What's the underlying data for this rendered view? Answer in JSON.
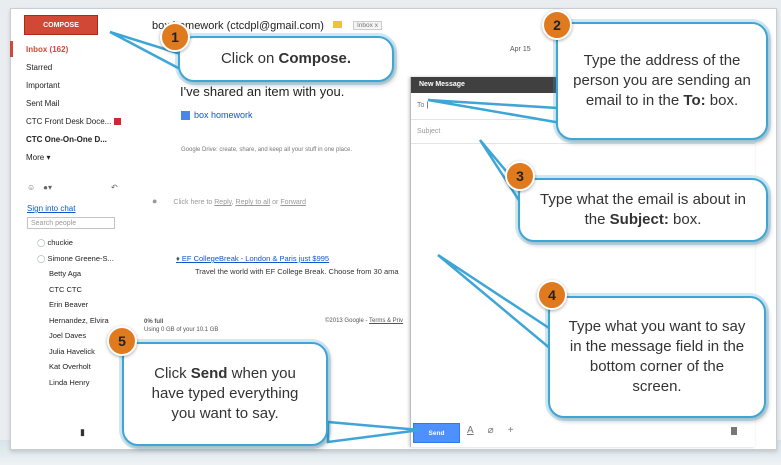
{
  "sidebar": {
    "compose": "COMPOSE",
    "items": [
      "Inbox (162)",
      "Starred",
      "Important",
      "Sent Mail",
      "CTC Front Desk Doce...",
      "CTC One-On-One D...",
      "More ▾"
    ],
    "chat_link": "Sign into chat",
    "search_people": "Search people",
    "contacts": [
      "chuckie",
      "Simone Greene-S...",
      "Betty Aga",
      "CTC CTC",
      "Erin Beaver",
      "Hernandez, Elvira",
      "Joel Daves",
      "Julia Havelick",
      "Kat Overholt",
      "Linda Henry"
    ],
    "storage_line1": "0% full",
    "storage_line2": "Using 0 GB of your 10.1 GB"
  },
  "message": {
    "header": "box homework (ctcdpl@gmail.com)",
    "inbox_tag": "Inbox",
    "inbox_close": "x",
    "subject": "I've shared an item with you.",
    "doc_link": "box homework",
    "drive_text": "Google Drive: create, share, and keep all your stuff in one place.",
    "reply_prefix": "Click here to",
    "reply": "Reply",
    "reply_all": "Reply to all",
    "or": "or",
    "forward": "Forward",
    "promo_title": "EF CollegeBreak - London & Paris just $995",
    "promo_text": "Travel the world with EF College Break. Choose from 30 ama",
    "copyright": "©2013 Google - ",
    "terms": "Terms & Priv",
    "date": "Apr 15"
  },
  "compose_window": {
    "title": "New Message",
    "to_label": "To",
    "subject_placeholder": "Subject",
    "send": "Send",
    "tool_icons": [
      "A",
      "⌀",
      "+"
    ]
  },
  "callouts": [
    {
      "number": "1",
      "text_pre": "Click on ",
      "bold": "Compose.",
      "text_post": ""
    },
    {
      "number": "2",
      "text_pre": "Type the address of the person you are sending an email to in the ",
      "bold": "To:",
      "text_post": " box."
    },
    {
      "number": "3",
      "text_pre": "Type what the email is about in the ",
      "bold": "Subject:",
      "text_post": " box."
    },
    {
      "number": "4",
      "text_pre": "Type what you want to say in the message field in the bottom corner of the screen.",
      "bold": "",
      "text_post": ""
    },
    {
      "number": "5",
      "text_pre": "Click ",
      "bold": "Send",
      "text_post": " when you have typed everything you want to say."
    }
  ],
  "colors": {
    "compose_red": "#d14836",
    "callout_blue": "#3ea6d6",
    "badge_orange": "#e07a1f",
    "send_blue": "#4d90fe"
  }
}
